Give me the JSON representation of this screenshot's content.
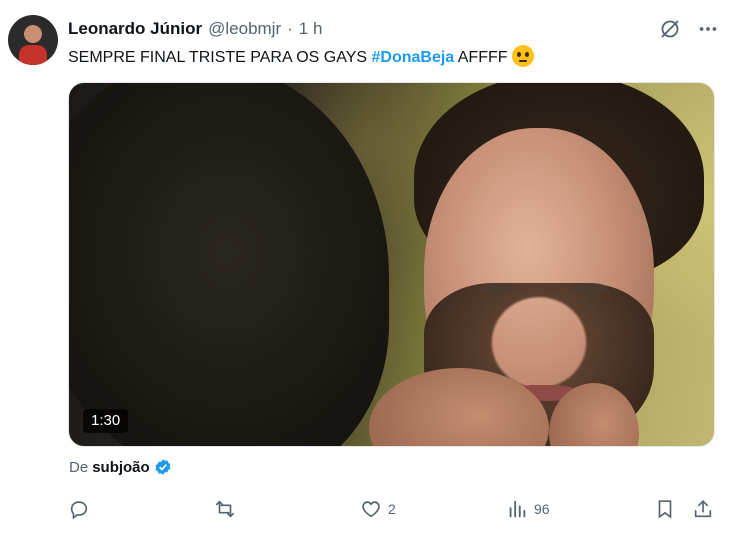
{
  "tweet": {
    "author_name": "Leonardo Júnior",
    "handle": "@leobmjr",
    "separator": "·",
    "time": "1 h",
    "text_before": "SEMPRE FINAL TRISTE PARA OS GAYS ",
    "hashtag": "#DonaBeja",
    "text_after": " AFFFF",
    "emoji": "face-with-rolling-eyes",
    "video_duration": "1:30",
    "attribution_prefix": "De",
    "attribution_name": "subjoão"
  },
  "actions": {
    "reply_count": "",
    "retweet_count": "",
    "like_count": "2",
    "views_count": "96"
  },
  "icons": {
    "grok": "grok-icon",
    "more": "more-icon",
    "verified": "verified-badge-icon",
    "reply": "reply-icon",
    "retweet": "retweet-icon",
    "like": "heart-icon",
    "views": "views-icon",
    "bookmark": "bookmark-icon",
    "share": "share-icon"
  },
  "colors": {
    "accent": "#1d9bf0",
    "text_primary": "#0f1419",
    "text_secondary": "#536471"
  }
}
